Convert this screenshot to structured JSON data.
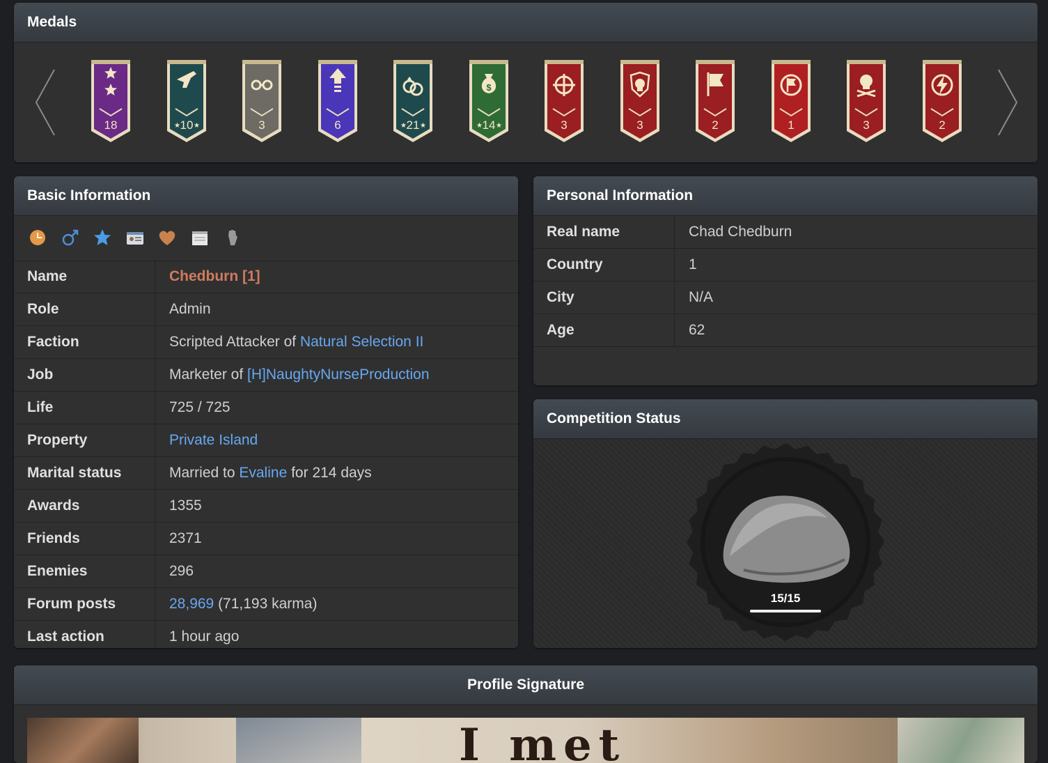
{
  "medals": {
    "title": "Medals",
    "items": [
      {
        "label": "18",
        "color": "#6a2a86",
        "icon": "two-stars-icon"
      },
      {
        "label": "10",
        "color": "#1f4a4d",
        "icon": "revolver-icon",
        "starred": true
      },
      {
        "label": "3",
        "color": "#6e6a64",
        "icon": "handcuffs-icon"
      },
      {
        "label": "6",
        "color": "#4a36b8",
        "icon": "up-arrow-icon"
      },
      {
        "label": "21",
        "color": "#1f4a4d",
        "icon": "rings-icon",
        "starred": true
      },
      {
        "label": "14",
        "color": "#2f6b34",
        "icon": "money-bag-icon",
        "starred": true
      },
      {
        "label": "3",
        "color": "#9a1e22",
        "icon": "crosshair-icon"
      },
      {
        "label": "3",
        "color": "#9a1e22",
        "icon": "skull-shield-icon"
      },
      {
        "label": "2",
        "color": "#9a1e22",
        "icon": "pirate-flag-icon"
      },
      {
        "label": "1",
        "color": "#b01f22",
        "icon": "flag-circle-icon"
      },
      {
        "label": "3",
        "color": "#9a1e22",
        "icon": "skull-crossbones-icon"
      },
      {
        "label": "2",
        "color": "#9a1e22",
        "icon": "lightning-icon"
      }
    ]
  },
  "basic": {
    "title": "Basic Information",
    "icons": [
      "clock-icon",
      "male-icon",
      "star-icon",
      "id-card-icon",
      "heart-icon",
      "notepad-icon",
      "fist-icon"
    ],
    "rows": {
      "name": {
        "key": "Name",
        "value": "Chedburn [1]"
      },
      "role": {
        "key": "Role",
        "value": "Admin"
      },
      "faction": {
        "key": "Faction",
        "prefix": "Scripted Attacker of ",
        "link": "Natural Selection II"
      },
      "job": {
        "key": "Job",
        "prefix": "Marketer of ",
        "link": "[H]NaughtyNurseProduction"
      },
      "life": {
        "key": "Life",
        "value": "725 / 725"
      },
      "property": {
        "key": "Property",
        "link": "Private Island"
      },
      "marital": {
        "key": "Marital status",
        "prefix": "Married to ",
        "link": "Evaline",
        "suffix": " for 214 days"
      },
      "awards": {
        "key": "Awards",
        "value": "1355"
      },
      "friends": {
        "key": "Friends",
        "value": "2371"
      },
      "enemies": {
        "key": "Enemies",
        "value": "296"
      },
      "forum": {
        "key": "Forum posts",
        "link": "28,969",
        "suffix": " (71,193 karma)"
      },
      "last": {
        "key": "Last action",
        "value": "1 hour ago"
      }
    }
  },
  "personal": {
    "title": "Personal Information",
    "rows": [
      {
        "key": "Real name",
        "value": "Chad Chedburn"
      },
      {
        "key": "Country",
        "value": "1"
      },
      {
        "key": "City",
        "value": "N/A"
      },
      {
        "key": "Age",
        "value": "62"
      }
    ]
  },
  "competition": {
    "title": "Competition Status",
    "count": "15/15",
    "progress": 1.0
  },
  "signature": {
    "title": "Profile Signature",
    "image_text": "I met"
  },
  "colors": {
    "link": "#67a8f0",
    "name": "#d07b5f",
    "panel": "#303030",
    "header": "#3d434a"
  }
}
